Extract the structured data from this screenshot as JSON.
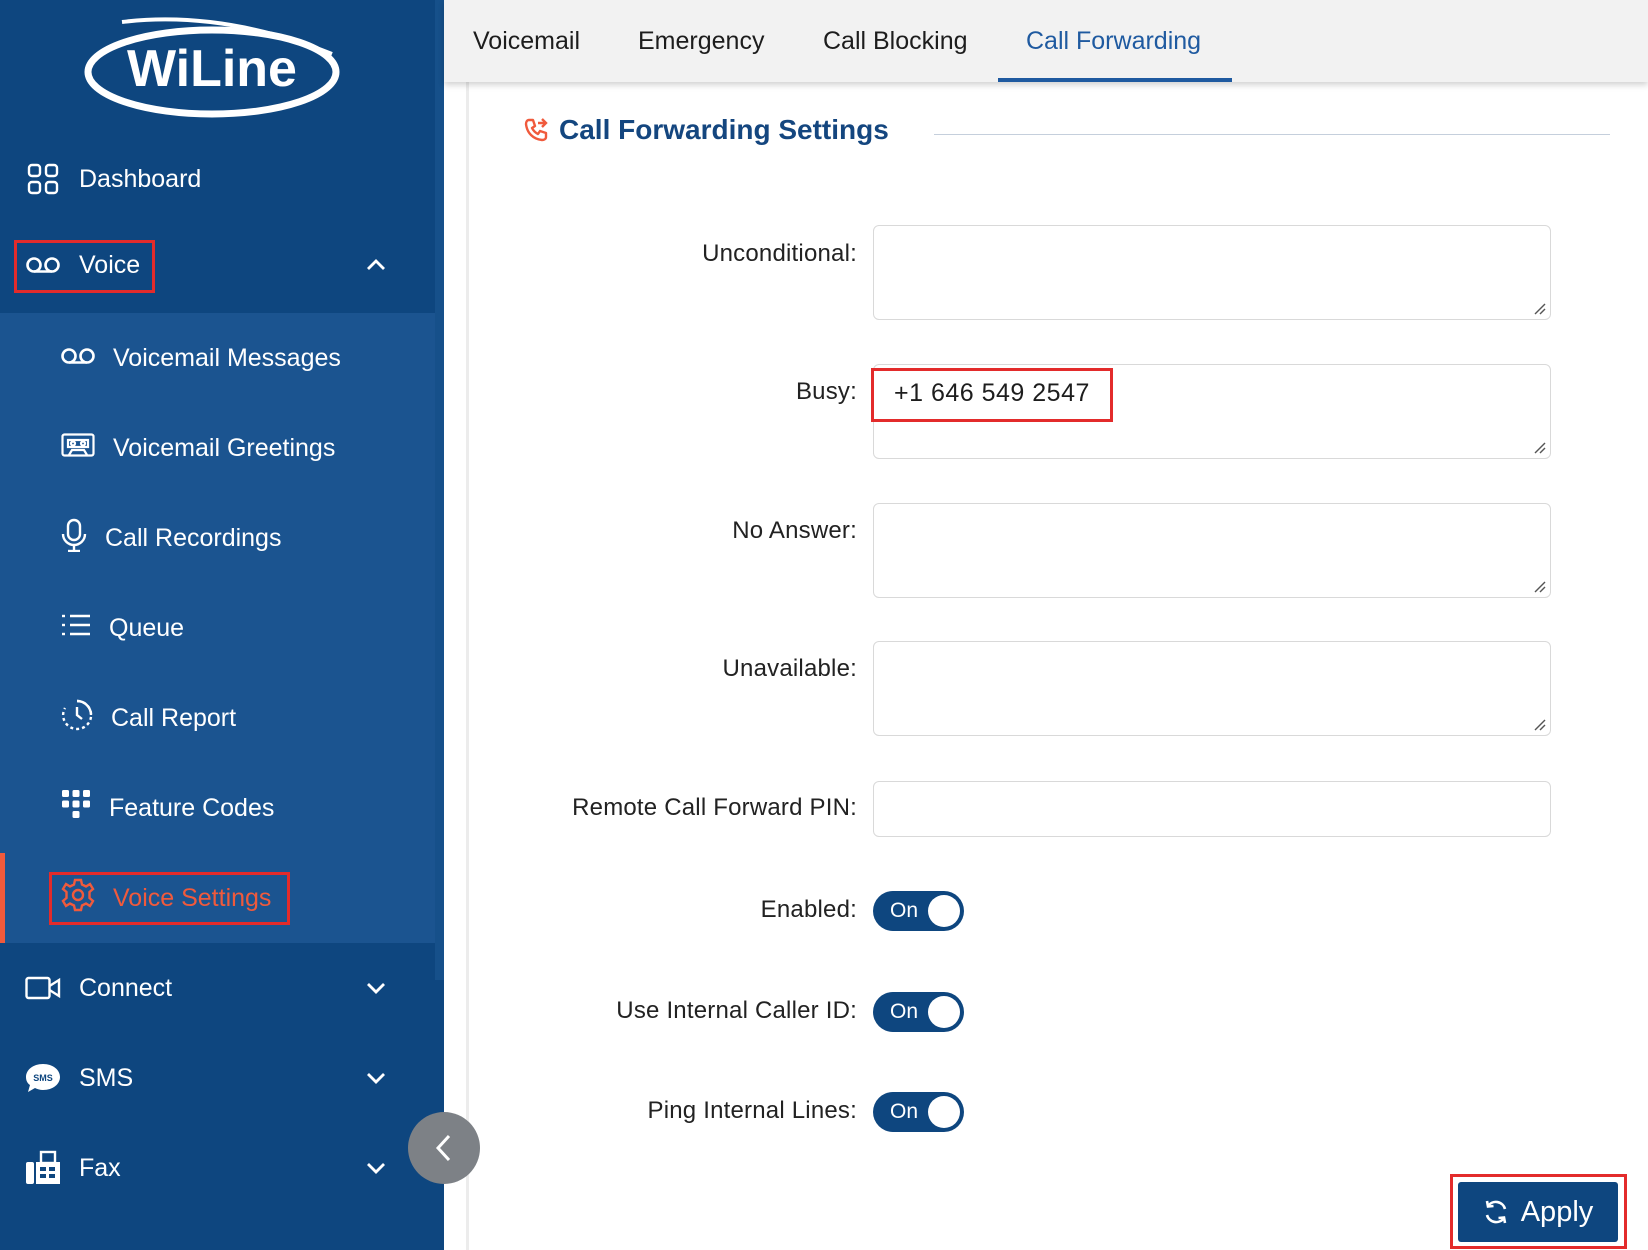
{
  "brand": {
    "logo_text": "WiLine"
  },
  "sidebar": {
    "items": [
      {
        "label": "Dashboard"
      },
      {
        "label": "Voice"
      },
      {
        "label": "Connect"
      },
      {
        "label": "SMS"
      },
      {
        "label": "Fax"
      }
    ],
    "voice_submenu": [
      {
        "label": "Voicemail Messages"
      },
      {
        "label": "Voicemail Greetings"
      },
      {
        "label": "Call Recordings"
      },
      {
        "label": "Queue"
      },
      {
        "label": "Call Report"
      },
      {
        "label": "Feature Codes"
      },
      {
        "label": "Voice Settings"
      }
    ],
    "active_item": "Voice Settings",
    "active_color": "#f05a3c",
    "background_color": "#0e467f"
  },
  "tabs": [
    {
      "label": "Voicemail"
    },
    {
      "label": "Emergency"
    },
    {
      "label": "Call Blocking"
    },
    {
      "label": "Call Forwarding"
    }
  ],
  "active_tab": "Call Forwarding",
  "section": {
    "title": "Call Forwarding Settings"
  },
  "form": {
    "unconditional": {
      "label": "Unconditional",
      "value": ""
    },
    "busy": {
      "label": "Busy",
      "value": "+1 646 549 2547"
    },
    "no_answer": {
      "label": "No Answer",
      "value": ""
    },
    "unavailable": {
      "label": "Unavailable",
      "value": ""
    },
    "remote_pin": {
      "label": "Remote Call Forward PIN",
      "value": ""
    },
    "enabled": {
      "label": "Enabled",
      "state": "On"
    },
    "internal_caller_id": {
      "label": "Use Internal Caller ID",
      "state": "On"
    },
    "ping_internal_lines": {
      "label": "Ping Internal Lines",
      "state": "On"
    }
  },
  "actions": {
    "apply_label": "Apply"
  }
}
